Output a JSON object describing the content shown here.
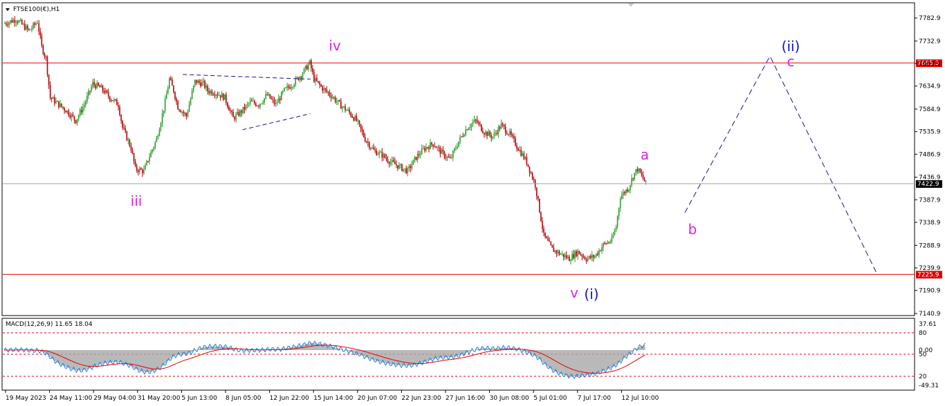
{
  "chart_data": [
    {
      "type": "candlestick",
      "title": "FTSE100(€),H1",
      "ylim": [
        7140.9,
        7782.9
      ],
      "y_ticks": [
        "7782.9",
        "7732.9",
        "7683.9",
        "7634.9",
        "7584.9",
        "7535.9",
        "7486.9",
        "7436.9",
        "7387.9",
        "7338.9",
        "7288.9",
        "7239.9",
        "7190.9",
        "7140.9"
      ],
      "x_ticks": [
        "19 May 2023",
        "24 May 11:00",
        "29 May 04:00",
        "31 May 20:00",
        "5 Jun 13:00",
        "8 Jun 05:00",
        "12 Jun 22:00",
        "15 Jun 14:00",
        "20 Jun 07:00",
        "22 Jun 23:00",
        "27 Jun 16:00",
        "30 Jun 08:00",
        "5 Jul 01:00",
        "7 Jul 17:00",
        "12 Jul 10:00"
      ],
      "horizontal_levels": [
        {
          "value": 7685.3,
          "label": "7685.3",
          "color": "#e00000"
        },
        {
          "value": 7225.9,
          "label": "7225.9",
          "color": "#e00000"
        },
        {
          "value": 7422.9,
          "label": "7422.9",
          "color": "#a0a0a0",
          "current": true
        }
      ],
      "price_path": [
        [
          0,
          7770
        ],
        [
          3,
          7780
        ],
        [
          6,
          7755
        ],
        [
          8,
          7775
        ],
        [
          9,
          7720
        ],
        [
          10,
          7695
        ],
        [
          11,
          7610
        ],
        [
          13,
          7595
        ],
        [
          15,
          7580
        ],
        [
          17,
          7560
        ],
        [
          19,
          7595
        ],
        [
          21,
          7640
        ],
        [
          23,
          7630
        ],
        [
          25,
          7610
        ],
        [
          27,
          7595
        ],
        [
          28,
          7545
        ],
        [
          30,
          7500
        ],
        [
          31,
          7455
        ],
        [
          33,
          7450
        ],
        [
          34,
          7475
        ],
        [
          36,
          7520
        ],
        [
          38,
          7600
        ],
        [
          39,
          7650
        ],
        [
          40,
          7625
        ],
        [
          41,
          7590
        ],
        [
          43,
          7570
        ],
        [
          45,
          7645
        ],
        [
          47,
          7640
        ],
        [
          48,
          7625
        ],
        [
          50,
          7620
        ],
        [
          52,
          7610
        ],
        [
          54,
          7565
        ],
        [
          56,
          7580
        ],
        [
          58,
          7600
        ],
        [
          60,
          7595
        ],
        [
          62,
          7615
        ],
        [
          64,
          7595
        ],
        [
          66,
          7625
        ],
        [
          68,
          7640
        ],
        [
          70,
          7660
        ],
        [
          72,
          7685
        ],
        [
          73,
          7650
        ],
        [
          75,
          7630
        ],
        [
          77,
          7615
        ],
        [
          79,
          7595
        ],
        [
          81,
          7580
        ],
        [
          83,
          7560
        ],
        [
          85,
          7520
        ],
        [
          87,
          7495
        ],
        [
          89,
          7485
        ],
        [
          91,
          7470
        ],
        [
          93,
          7460
        ],
        [
          95,
          7450
        ],
        [
          97,
          7480
        ],
        [
          99,
          7500
        ],
        [
          101,
          7510
        ],
        [
          103,
          7490
        ],
        [
          105,
          7475
        ],
        [
          107,
          7515
        ],
        [
          109,
          7545
        ],
        [
          111,
          7560
        ],
        [
          113,
          7535
        ],
        [
          115,
          7525
        ],
        [
          117,
          7550
        ],
        [
          119,
          7530
        ],
        [
          121,
          7500
        ],
        [
          123,
          7470
        ],
        [
          125,
          7420
        ],
        [
          127,
          7310
        ],
        [
          129,
          7280
        ],
        [
          131,
          7270
        ],
        [
          133,
          7260
        ],
        [
          135,
          7275
        ],
        [
          137,
          7260
        ],
        [
          139,
          7265
        ],
        [
          141,
          7290
        ],
        [
          143,
          7300
        ],
        [
          144,
          7330
        ],
        [
          145,
          7395
        ],
        [
          146,
          7405
        ],
        [
          147,
          7415
        ],
        [
          148,
          7440
        ],
        [
          149,
          7455
        ],
        [
          150,
          7440
        ],
        [
          151,
          7423
        ]
      ],
      "projection_path": [
        [
          160,
          7360
        ],
        [
          180,
          7700
        ],
        [
          205,
          7230
        ]
      ],
      "triangle_lines": [
        {
          "from": [
            42,
            7660
          ],
          "to": [
            72,
            7650
          ]
        },
        {
          "from": [
            56,
            7540
          ],
          "to": [
            72,
            7575
          ]
        }
      ],
      "wave_labels": [
        {
          "text": "iii",
          "color": "#e020e0"
        },
        {
          "text": "iv",
          "color": "#e020e0"
        },
        {
          "text": "v",
          "color": "#e020e0"
        },
        {
          "text": "(i)",
          "color": "#1010c8"
        },
        {
          "text": "a",
          "color": "#e020e0"
        },
        {
          "text": "b",
          "color": "#e020e0"
        },
        {
          "text": "c",
          "color": "#e020e0"
        },
        {
          "text": "(ii)",
          "color": "#1010c8"
        }
      ]
    },
    {
      "type": "macd",
      "title": "MACD(12,26,9) 11.65 18.04",
      "y_ticks": [
        "37.61",
        "80",
        "50",
        "0.00",
        "20",
        "-49.31"
      ],
      "signal_line_color": "#e00000",
      "macd_line_color": "#1e7fe0",
      "histogram_color": "#a8a8a8"
    }
  ],
  "colors": {
    "bull": "#2a9a2a",
    "bear": "#b00000",
    "projection": "#1010a0",
    "current_price_bg": "#000000"
  }
}
